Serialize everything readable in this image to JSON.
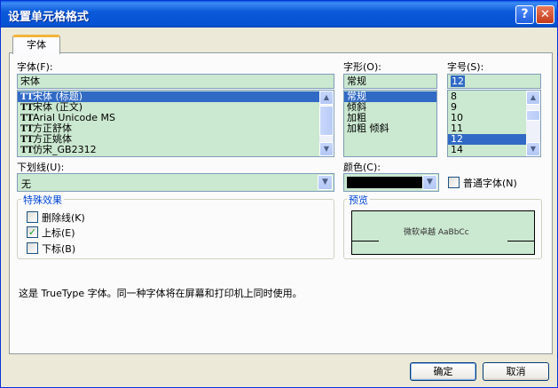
{
  "title": "设置单元格格式",
  "titlebar": {
    "help_glyph": "?",
    "close_glyph": "✕"
  },
  "tabs": [
    {
      "label": "字体"
    }
  ],
  "font": {
    "label": "字体(F):",
    "value": "宋体",
    "items": [
      {
        "label": "宋体 (标题)",
        "selected": true
      },
      {
        "label": "宋体 (正文)",
        "selected": false
      },
      {
        "label": "Arial Unicode MS",
        "selected": false
      },
      {
        "label": "方正舒体",
        "selected": false
      },
      {
        "label": "方正姚体",
        "selected": false
      },
      {
        "label": "仿宋_GB2312",
        "selected": false
      }
    ]
  },
  "style": {
    "label": "字形(O):",
    "value": "常规",
    "items": [
      {
        "label": "常规",
        "selected": true
      },
      {
        "label": "倾斜",
        "selected": false
      },
      {
        "label": "加粗",
        "selected": false
      },
      {
        "label": "加粗 倾斜",
        "selected": false
      }
    ]
  },
  "size": {
    "label": "字号(S):",
    "value": "12",
    "items": [
      {
        "label": "8",
        "selected": false
      },
      {
        "label": "9",
        "selected": false
      },
      {
        "label": "10",
        "selected": false
      },
      {
        "label": "11",
        "selected": false
      },
      {
        "label": "12",
        "selected": true
      },
      {
        "label": "14",
        "selected": false
      }
    ]
  },
  "underline": {
    "label": "下划线(U):",
    "value": "无"
  },
  "color": {
    "label": "颜色(C):",
    "value": "#000000"
  },
  "normal_font": {
    "label": "普通字体(N)",
    "checked": false
  },
  "effects": {
    "title": "特殊效果",
    "strikethrough": {
      "label": "删除线(K)",
      "checked": false
    },
    "superscript": {
      "label": "上标(E)",
      "checked": true
    },
    "subscript": {
      "label": "下标(B)",
      "checked": false
    }
  },
  "preview": {
    "title": "预览",
    "sample": "微软卓越  AaBbCc"
  },
  "info": "这是 TrueType 字体。同一种字体将在屏幕和打印机上同时使用。",
  "buttons": {
    "ok": "确定",
    "cancel": "取消"
  },
  "icons": {
    "truetype": "TT",
    "scroll_up": "▲",
    "scroll_down": "▼",
    "combo_arrow": "▼",
    "check": "✓"
  },
  "colors": {
    "selection": "#316ac5",
    "field": "#cbe8d0",
    "group_title": "#0046d5",
    "titlebar": "#0553d4"
  }
}
